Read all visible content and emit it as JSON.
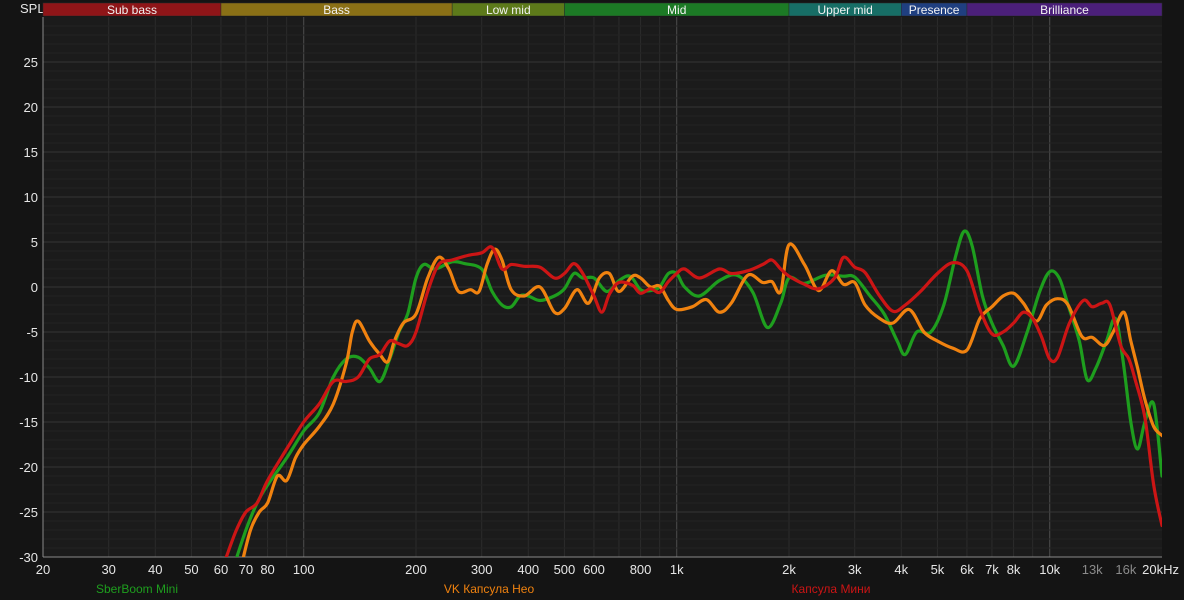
{
  "chart_data": {
    "type": "line",
    "ylabel": "SPL",
    "x_scale": "log",
    "xlim": [
      20,
      20000
    ],
    "ylim": [
      -30,
      30
    ],
    "grid": true,
    "legend_position": "bottom",
    "x_tick_labels": [
      {
        "value": 20,
        "label": "20"
      },
      {
        "value": 30,
        "label": "30"
      },
      {
        "value": 40,
        "label": "40"
      },
      {
        "value": 50,
        "label": "50"
      },
      {
        "value": 60,
        "label": "60"
      },
      {
        "value": 70,
        "label": "70"
      },
      {
        "value": 80,
        "label": "80"
      },
      {
        "value": 100,
        "label": "100"
      },
      {
        "value": 200,
        "label": "200"
      },
      {
        "value": 300,
        "label": "300"
      },
      {
        "value": 400,
        "label": "400"
      },
      {
        "value": 500,
        "label": "500"
      },
      {
        "value": 600,
        "label": "600"
      },
      {
        "value": 800,
        "label": "800"
      },
      {
        "value": 1000,
        "label": "1k"
      },
      {
        "value": 2000,
        "label": "2k"
      },
      {
        "value": 3000,
        "label": "3k"
      },
      {
        "value": 4000,
        "label": "4k"
      },
      {
        "value": 5000,
        "label": "5k"
      },
      {
        "value": 6000,
        "label": "6k"
      },
      {
        "value": 7000,
        "label": "7k"
      },
      {
        "value": 8000,
        "label": "8k"
      },
      {
        "value": 10000,
        "label": "10k"
      },
      {
        "value": 13000,
        "label": "13k",
        "dim": true
      },
      {
        "value": 16000,
        "label": "16k",
        "dim": true
      },
      {
        "value": 20000,
        "label": "20kHz"
      }
    ],
    "y_ticks": [
      -30,
      -25,
      -20,
      -15,
      -10,
      -5,
      0,
      5,
      10,
      15,
      20,
      25
    ],
    "bands": [
      {
        "label": "Sub bass",
        "from": 20,
        "to": 60,
        "color": "#8f1518"
      },
      {
        "label": "Bass",
        "from": 60,
        "to": 250,
        "color": "#8a7016"
      },
      {
        "label": "Low mid",
        "from": 250,
        "to": 500,
        "color": "#5d7a1a"
      },
      {
        "label": "Mid",
        "from": 500,
        "to": 2000,
        "color": "#1c7a25"
      },
      {
        "label": "Upper mid",
        "from": 2000,
        "to": 4000,
        "color": "#176e66"
      },
      {
        "label": "Presence",
        "from": 4000,
        "to": 6000,
        "color": "#1f3f80"
      },
      {
        "label": "Brilliance",
        "from": 6000,
        "to": 20000,
        "color": "#4b1f7a"
      }
    ],
    "series": [
      {
        "name": "SberBoom Mini",
        "color": "#1e9e1e",
        "points": [
          [
            65,
            -31
          ],
          [
            70,
            -27
          ],
          [
            75,
            -24
          ],
          [
            80,
            -22
          ],
          [
            90,
            -19
          ],
          [
            100,
            -16
          ],
          [
            110,
            -14
          ],
          [
            120,
            -10
          ],
          [
            130,
            -8
          ],
          [
            140,
            -7.8
          ],
          [
            150,
            -9
          ],
          [
            160,
            -10.5
          ],
          [
            170,
            -8
          ],
          [
            180,
            -5
          ],
          [
            190,
            -3
          ],
          [
            200,
            1
          ],
          [
            210,
            2.5
          ],
          [
            225,
            2
          ],
          [
            250,
            2.8
          ],
          [
            270,
            2.6
          ],
          [
            300,
            2
          ],
          [
            320,
            -0.5
          ],
          [
            340,
            -2
          ],
          [
            360,
            -2.2
          ],
          [
            380,
            -1
          ],
          [
            400,
            -1
          ],
          [
            430,
            -1.5
          ],
          [
            470,
            -1
          ],
          [
            500,
            -0.2
          ],
          [
            530,
            1.5
          ],
          [
            560,
            1
          ],
          [
            600,
            1
          ],
          [
            650,
            -0.5
          ],
          [
            700,
            0.7
          ],
          [
            750,
            1.2
          ],
          [
            800,
            -0.3
          ],
          [
            850,
            -0.4
          ],
          [
            900,
            0
          ],
          [
            950,
            1.5
          ],
          [
            1000,
            1.5
          ],
          [
            1050,
            0
          ],
          [
            1150,
            -1
          ],
          [
            1300,
            0.7
          ],
          [
            1450,
            1.3
          ],
          [
            1600,
            -0.6
          ],
          [
            1750,
            -4.5
          ],
          [
            1900,
            -1.8
          ],
          [
            2000,
            1
          ],
          [
            2200,
            0.4
          ],
          [
            2500,
            1.3
          ],
          [
            2800,
            1.2
          ],
          [
            3000,
            1.1
          ],
          [
            3300,
            -1
          ],
          [
            3600,
            -3
          ],
          [
            3900,
            -6
          ],
          [
            4100,
            -7.5
          ],
          [
            4400,
            -5
          ],
          [
            4800,
            -5
          ],
          [
            5200,
            -2
          ],
          [
            5600,
            3.5
          ],
          [
            5900,
            6.2
          ],
          [
            6200,
            4.5
          ],
          [
            6600,
            -1
          ],
          [
            7000,
            -4
          ],
          [
            7500,
            -6.5
          ],
          [
            8000,
            -8.8
          ],
          [
            8700,
            -5
          ],
          [
            9400,
            -0.5
          ],
          [
            10000,
            1.7
          ],
          [
            10600,
            1
          ],
          [
            11200,
            -2
          ],
          [
            12000,
            -6
          ],
          [
            12600,
            -10.3
          ],
          [
            13300,
            -9
          ],
          [
            14200,
            -6
          ],
          [
            15000,
            -3.5
          ],
          [
            15700,
            -8
          ],
          [
            16500,
            -15
          ],
          [
            17200,
            -18
          ],
          [
            18000,
            -15
          ],
          [
            19000,
            -13
          ],
          [
            20000,
            -21
          ]
        ]
      },
      {
        "name": "VK Капсула Нео",
        "color": "#f0820f",
        "points": [
          [
            68,
            -31
          ],
          [
            72,
            -27
          ],
          [
            76,
            -25
          ],
          [
            80,
            -24
          ],
          [
            85,
            -21
          ],
          [
            90,
            -21.5
          ],
          [
            95,
            -19
          ],
          [
            100,
            -17.5
          ],
          [
            110,
            -15.5
          ],
          [
            120,
            -13
          ],
          [
            130,
            -8.5
          ],
          [
            135,
            -5
          ],
          [
            140,
            -3.8
          ],
          [
            150,
            -6
          ],
          [
            160,
            -7.5
          ],
          [
            168,
            -8.3
          ],
          [
            175,
            -6
          ],
          [
            185,
            -4
          ],
          [
            200,
            -3
          ],
          [
            215,
            1
          ],
          [
            230,
            3.3
          ],
          [
            245,
            2
          ],
          [
            260,
            -0.5
          ],
          [
            280,
            -0.3
          ],
          [
            295,
            -0.5
          ],
          [
            310,
            2.5
          ],
          [
            325,
            4.2
          ],
          [
            340,
            3
          ],
          [
            360,
            -0.3
          ],
          [
            390,
            -1
          ],
          [
            430,
            0
          ],
          [
            470,
            -2.8
          ],
          [
            500,
            -2.4
          ],
          [
            540,
            -0.3
          ],
          [
            580,
            -1.8
          ],
          [
            620,
            1
          ],
          [
            660,
            1.5
          ],
          [
            700,
            -0.5
          ],
          [
            760,
            1.2
          ],
          [
            800,
            1
          ],
          [
            850,
            0
          ],
          [
            900,
            0.1
          ],
          [
            950,
            -1.5
          ],
          [
            1000,
            -2.5
          ],
          [
            1100,
            -2.2
          ],
          [
            1200,
            -1.4
          ],
          [
            1300,
            -2.8
          ],
          [
            1400,
            -1.8
          ],
          [
            1550,
            1.3
          ],
          [
            1700,
            0.5
          ],
          [
            1800,
            0.6
          ],
          [
            1900,
            -0.5
          ],
          [
            2000,
            4.7
          ],
          [
            2200,
            2.5
          ],
          [
            2400,
            -0.4
          ],
          [
            2600,
            1.8
          ],
          [
            2800,
            0.3
          ],
          [
            3000,
            0.5
          ],
          [
            3200,
            -2
          ],
          [
            3500,
            -3.5
          ],
          [
            3800,
            -4
          ],
          [
            4200,
            -2.5
          ],
          [
            4600,
            -5
          ],
          [
            5000,
            -6
          ],
          [
            5500,
            -6.8
          ],
          [
            6000,
            -7
          ],
          [
            6500,
            -3.5
          ],
          [
            7000,
            -2.2
          ],
          [
            7500,
            -1
          ],
          [
            8000,
            -0.7
          ],
          [
            8500,
            -1.8
          ],
          [
            9200,
            -3.8
          ],
          [
            9800,
            -2
          ],
          [
            10500,
            -1.3
          ],
          [
            11200,
            -2
          ],
          [
            12200,
            -5.5
          ],
          [
            13000,
            -5.6
          ],
          [
            14000,
            -6.5
          ],
          [
            14800,
            -5
          ],
          [
            15800,
            -2.8
          ],
          [
            16500,
            -6
          ],
          [
            17200,
            -9
          ],
          [
            18000,
            -12.5
          ],
          [
            19000,
            -15.5
          ],
          [
            20000,
            -16.5
          ]
        ]
      },
      {
        "name": "Капсула Мини",
        "color": "#cc1515",
        "points": [
          [
            62,
            -30
          ],
          [
            66,
            -27
          ],
          [
            70,
            -25
          ],
          [
            75,
            -24
          ],
          [
            80,
            -21.5
          ],
          [
            90,
            -18
          ],
          [
            100,
            -15
          ],
          [
            110,
            -13
          ],
          [
            120,
            -10.5
          ],
          [
            130,
            -10.5
          ],
          [
            140,
            -10
          ],
          [
            150,
            -8
          ],
          [
            160,
            -7.5
          ],
          [
            170,
            -6
          ],
          [
            180,
            -6.3
          ],
          [
            190,
            -6.5
          ],
          [
            200,
            -5
          ],
          [
            215,
            -0.5
          ],
          [
            230,
            2.5
          ],
          [
            250,
            3
          ],
          [
            275,
            3.5
          ],
          [
            300,
            3.8
          ],
          [
            320,
            4.4
          ],
          [
            340,
            2
          ],
          [
            360,
            2.5
          ],
          [
            390,
            2.3
          ],
          [
            430,
            2.2
          ],
          [
            470,
            1
          ],
          [
            500,
            1.5
          ],
          [
            530,
            2.6
          ],
          [
            560,
            1.5
          ],
          [
            600,
            -1
          ],
          [
            630,
            -2.8
          ],
          [
            660,
            -0.8
          ],
          [
            700,
            0.5
          ],
          [
            760,
            0.2
          ],
          [
            800,
            -0.7
          ],
          [
            850,
            -0.2
          ],
          [
            900,
            -0.6
          ],
          [
            950,
            0.6
          ],
          [
            1000,
            1.5
          ],
          [
            1050,
            2
          ],
          [
            1150,
            1
          ],
          [
            1300,
            2
          ],
          [
            1400,
            1.5
          ],
          [
            1550,
            1.8
          ],
          [
            1700,
            2.5
          ],
          [
            1800,
            3
          ],
          [
            1900,
            2
          ],
          [
            2000,
            1.2
          ],
          [
            2200,
            0.3
          ],
          [
            2400,
            -0.2
          ],
          [
            2650,
            1
          ],
          [
            2800,
            3.3
          ],
          [
            3000,
            2.2
          ],
          [
            3200,
            1.6
          ],
          [
            3500,
            -1
          ],
          [
            3800,
            -2.7
          ],
          [
            4100,
            -2
          ],
          [
            4500,
            -0.5
          ],
          [
            5000,
            1.5
          ],
          [
            5500,
            2.7
          ],
          [
            6000,
            1.8
          ],
          [
            6500,
            -2.5
          ],
          [
            7000,
            -5.2
          ],
          [
            7500,
            -5
          ],
          [
            8000,
            -4
          ],
          [
            8500,
            -2.8
          ],
          [
            9000,
            -3.5
          ],
          [
            9500,
            -5.5
          ],
          [
            10000,
            -8
          ],
          [
            10500,
            -7.8
          ],
          [
            11300,
            -4
          ],
          [
            12300,
            -1.5
          ],
          [
            13000,
            -2.2
          ],
          [
            13800,
            -1.8
          ],
          [
            14500,
            -2
          ],
          [
            15500,
            -6.5
          ],
          [
            16300,
            -8
          ],
          [
            17000,
            -10.5
          ],
          [
            18000,
            -14.5
          ],
          [
            19000,
            -22
          ],
          [
            20000,
            -26.5
          ]
        ]
      }
    ]
  }
}
